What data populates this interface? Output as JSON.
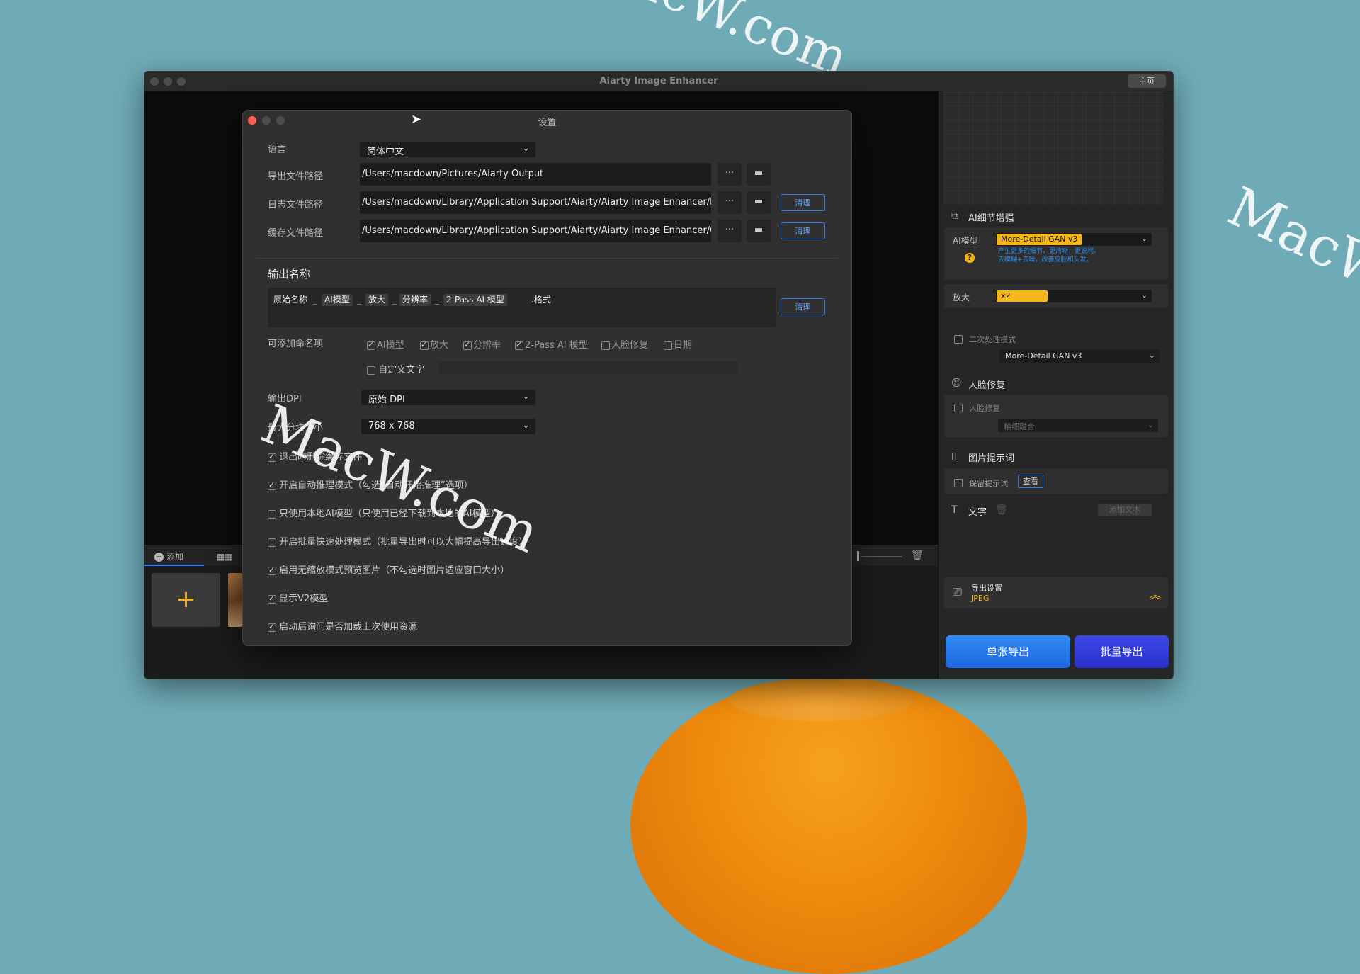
{
  "app": {
    "title": "Aiarty Image Enhancer",
    "home_button": "主页"
  },
  "watermark": "MacW.com",
  "bottom_bar": {
    "add_label": "添加",
    "add_tile": "+"
  },
  "settings": {
    "title": "设置",
    "language_label": "语言",
    "language_value": "简体中文",
    "export_path_label": "导出文件路径",
    "export_path_value": "/Users/macdown/Pictures/Aiarty Output",
    "log_path_label": "日志文件路径",
    "log_path_value": "/Users/macdown/Library/Application Support/Aiarty/Aiarty Image Enhancer/log",
    "cache_path_label": "缓存文件路径",
    "cache_path_value": "/Users/macdown/Library/Application Support/Aiarty/Aiarty Image Enhancer/Cache",
    "browse_label": "···",
    "folder_icon": "folder-icon",
    "clear_label": "清理",
    "output_name_heading": "输出名称",
    "name_tokens": [
      "原始名称",
      "_",
      "AI模型",
      "_",
      "放大",
      "_",
      "分辨率",
      "_",
      "2-Pass AI 模型",
      ".格式"
    ],
    "naming_items_label": "可添加命名项",
    "naming_options": [
      {
        "label": "AI模型",
        "checked": true
      },
      {
        "label": "放大",
        "checked": true
      },
      {
        "label": "分辨率",
        "checked": true
      },
      {
        "label": "2-Pass AI 模型",
        "checked": true
      },
      {
        "label": "人脸修复",
        "checked": false
      },
      {
        "label": "日期",
        "checked": false
      }
    ],
    "custom_text_label": "自定义文字",
    "dpi_label": "输出DPI",
    "dpi_value": "原始 DPI",
    "tile_label": "最大分块大小",
    "tile_value": "768 x 768",
    "checks": [
      {
        "label": "退出时删除缓存文件",
        "checked": true
      },
      {
        "label": "开启自动推理模式（勾选“自动开始推理”选项）",
        "checked": true
      },
      {
        "label": "只使用本地AI模型（只使用已经下载到本地的AI模型）",
        "checked": false
      },
      {
        "label": "开启批量快速处理模式（批量导出时可以大幅提高导出速度）",
        "checked": false
      },
      {
        "label": "启用无缩放模式预览图片（不勾选时图片适应窗口大小）",
        "checked": true
      },
      {
        "label": "显示V2模型",
        "checked": true
      },
      {
        "label": "启动后询问是否加载上次使用资源",
        "checked": true
      }
    ]
  },
  "sidebar": {
    "enhance_title": "AI细节增强",
    "model_label": "AI模型",
    "model_value": "More-Detail GAN v3",
    "model_desc_line1": "产生更多的细节，更清晰，更锐利。",
    "model_desc_line2": "去模糊+去噪，改善皮肤和头发。",
    "scale_label": "放大",
    "scale_value": "x2",
    "second_pass_label": "二次处理模式",
    "second_pass_value": "More-Detail GAN v3",
    "face_title": "人脸修复",
    "face_check_label": "人脸修复",
    "face_mode_value": "精细融合",
    "prompt_title": "图片提示词",
    "keep_prompt_label": "保留提示词",
    "view_label": "查看",
    "text_title": "文字",
    "add_text_label": "添加文本",
    "export_settings_title": "导出设置",
    "export_format": "JPEG",
    "single_export": "单张导出",
    "batch_export": "批量导出"
  },
  "colors": {
    "accent_blue": "#2f7df6",
    "accent_yellow": "#f5b617",
    "close_red": "#ff5f57"
  }
}
